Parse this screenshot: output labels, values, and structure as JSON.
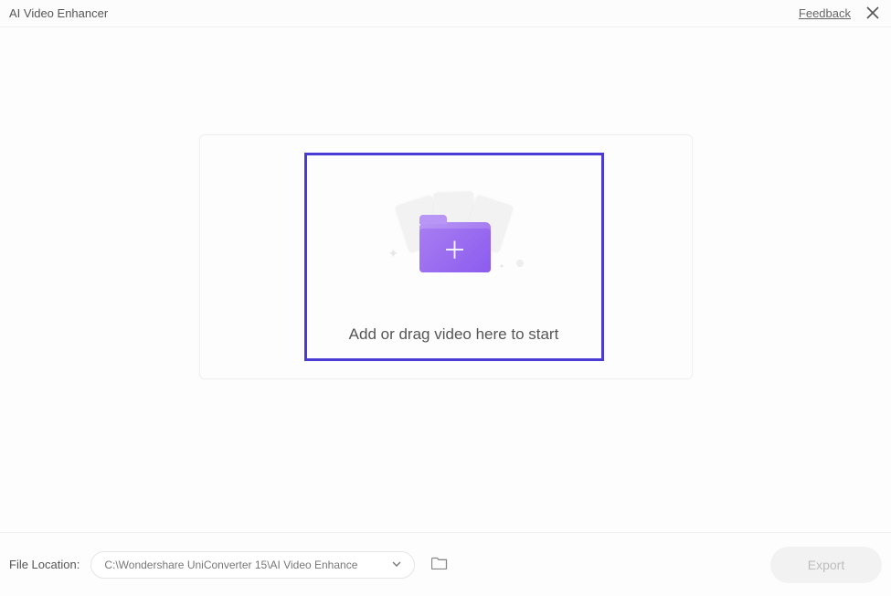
{
  "header": {
    "title": "AI Video Enhancer",
    "feedback_label": "Feedback"
  },
  "dropzone": {
    "prompt_text": "Add or drag video here to start"
  },
  "bottom": {
    "file_location_label": "File Location:",
    "file_location_value": "C:\\Wondershare UniConverter 15\\AI Video Enhance",
    "export_label": "Export"
  }
}
